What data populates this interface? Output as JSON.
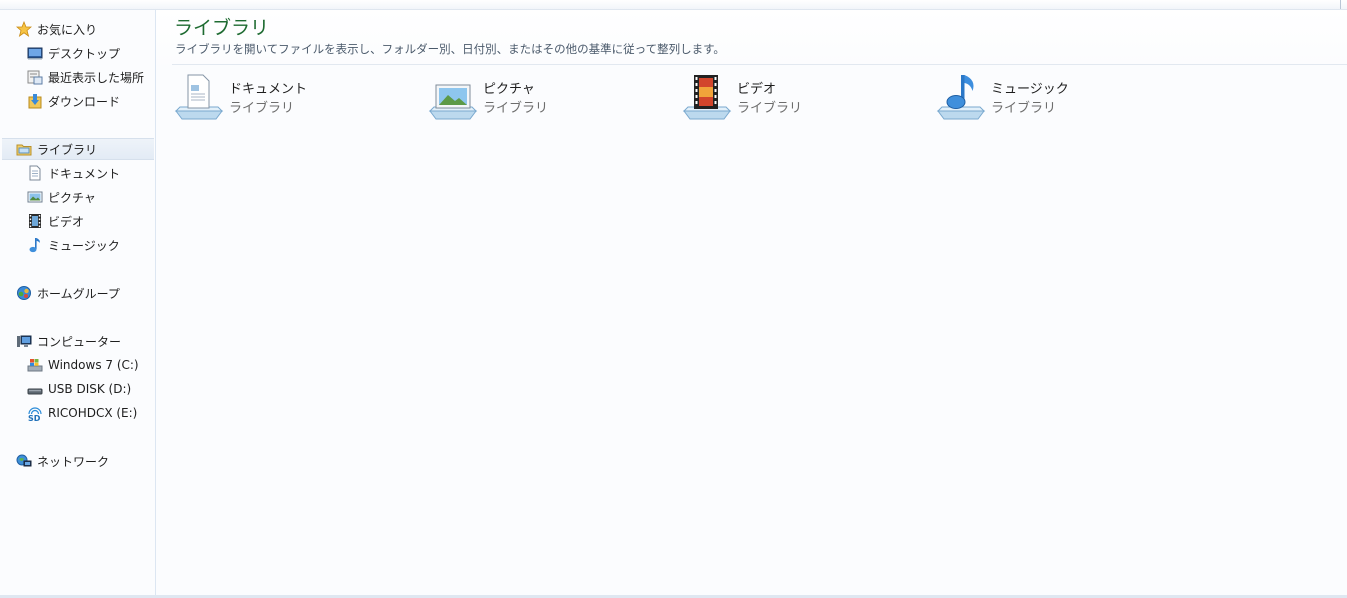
{
  "sidebar": {
    "favorites": {
      "label": "お気に入り",
      "items": [
        {
          "label": "デスクトップ"
        },
        {
          "label": "最近表示した場所"
        },
        {
          "label": "ダウンロード"
        }
      ]
    },
    "libraries": {
      "label": "ライブラリ",
      "items": [
        {
          "label": "ドキュメント"
        },
        {
          "label": "ピクチャ"
        },
        {
          "label": "ビデオ"
        },
        {
          "label": "ミュージック"
        }
      ]
    },
    "homegroup": {
      "label": "ホームグループ"
    },
    "computer": {
      "label": "コンピューター",
      "items": [
        {
          "label": "Windows 7 (C:)"
        },
        {
          "label": "USB DISK (D:)"
        },
        {
          "label": "RICOHDCX (E:)"
        }
      ]
    },
    "network": {
      "label": "ネットワーク"
    }
  },
  "main": {
    "title": "ライブラリ",
    "subtitle": "ライブラリを開いてファイルを表示し、フォルダー別、日付別、またはその他の基準に従って整列します。",
    "libraries": [
      {
        "name": "ドキュメント",
        "kind": "ライブラリ",
        "icon": "documents-library-icon"
      },
      {
        "name": "ピクチャ",
        "kind": "ライブラリ",
        "icon": "pictures-library-icon"
      },
      {
        "name": "ビデオ",
        "kind": "ライブラリ",
        "icon": "videos-library-icon"
      },
      {
        "name": "ミュージック",
        "kind": "ライブラリ",
        "icon": "music-library-icon"
      }
    ]
  },
  "colors": {
    "title": "#1e6b31",
    "selected_background": "#e3ebf5",
    "accent": "#3a7fc4"
  }
}
